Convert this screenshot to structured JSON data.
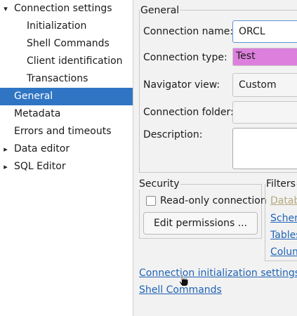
{
  "tree": {
    "items": [
      {
        "label": "Connection settings",
        "expanded": true
      },
      {
        "label": "Initialization"
      },
      {
        "label": "Shell Commands"
      },
      {
        "label": "Client identification"
      },
      {
        "label": "Transactions"
      },
      {
        "label": "General",
        "selected": true
      },
      {
        "label": "Metadata"
      },
      {
        "label": "Errors and timeouts"
      },
      {
        "label": "Data editor",
        "expanded": false
      },
      {
        "label": "SQL Editor",
        "expanded": false
      }
    ]
  },
  "general": {
    "title": "General",
    "connection_name_label": "Connection name:",
    "connection_name_value": "ORCL",
    "connection_type_label": "Connection type:",
    "connection_type_value": "Test",
    "connection_type_color": "#dd80dd",
    "navigator_view_label": "Navigator view:",
    "navigator_view_value": "Custom",
    "connection_folder_label": "Connection folder:",
    "connection_folder_value": "",
    "description_label": "Description:",
    "description_value": ""
  },
  "security": {
    "title": "Security",
    "readonly_label": "Read-only connection",
    "readonly_checked": false,
    "edit_permissions_label": "Edit permissions ..."
  },
  "filters": {
    "title": "Filters",
    "links": [
      "Datab",
      "Schen",
      "Tables",
      "Colum"
    ]
  },
  "links": {
    "init_settings": "Connection initialization settings",
    "shell_commands": "Shell Commands"
  },
  "colors": {
    "selection": "#2f75c4",
    "link": "#1f63b5",
    "disabled_link": "#b5a97e"
  }
}
